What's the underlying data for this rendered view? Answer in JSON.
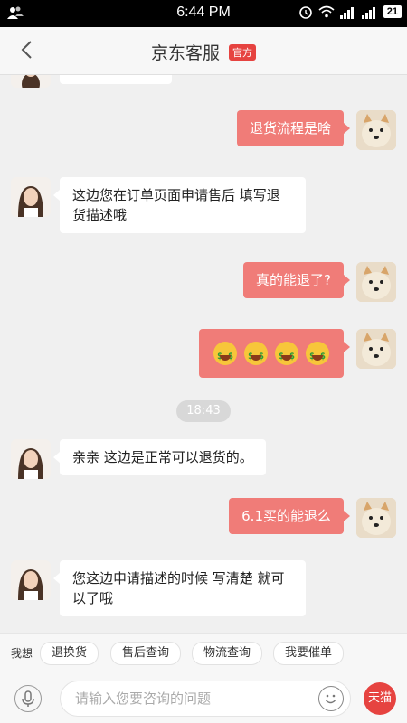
{
  "status": {
    "time": "6:44 PM",
    "battery": "21"
  },
  "header": {
    "title": "京东客服",
    "badge": "官方"
  },
  "messages": [
    {
      "text": "退货流程是啥"
    },
    {
      "text": "这边您在订单页面申请售后  填写退货描述哦"
    },
    {
      "text": "真的能退了?"
    },
    {
      "text": "😁😁😁😁"
    },
    {
      "text": "18:43"
    },
    {
      "text": "亲亲 这边是正常可以退货的。"
    },
    {
      "text": "6.1买的能退么"
    },
    {
      "text": "您这边申请描述的时候  写清楚 就可以了哦"
    }
  ],
  "quick": {
    "label": "我想",
    "items": [
      "退换货",
      "售后查询",
      "物流查询",
      "我要催单"
    ]
  },
  "input": {
    "placeholder": "请输入您要咨询的问题",
    "fab_label": "天猫"
  }
}
